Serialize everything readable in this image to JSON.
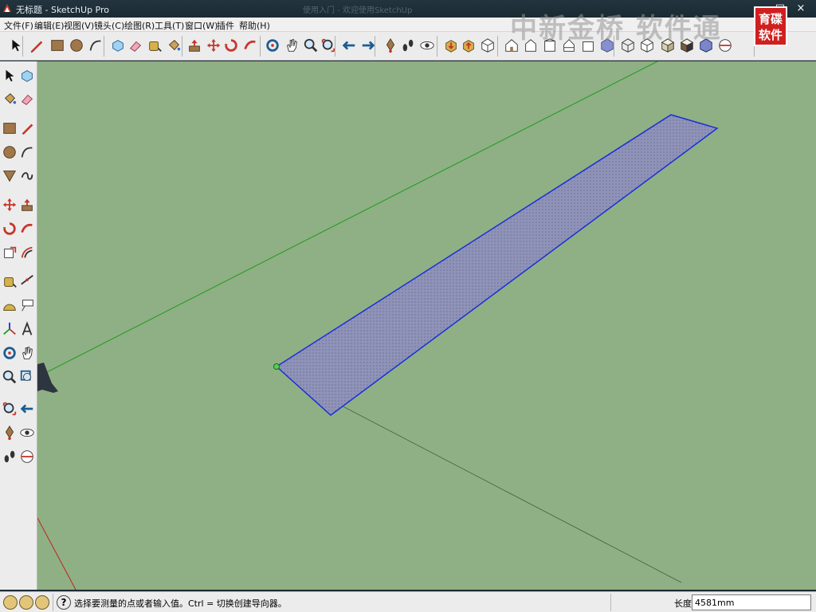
{
  "window": {
    "title": "无标题 - SketchUp Pro",
    "ghost_title": "使用入门 - 欢迎使用SketchUp",
    "controls": [
      "−",
      "□",
      "×"
    ]
  },
  "menu": [
    {
      "label": "文件(F)"
    },
    {
      "label": "编辑(E)"
    },
    {
      "label": "视图(V)"
    },
    {
      "label": "镜头(C)"
    },
    {
      "label": "绘图(R)"
    },
    {
      "label": "工具(T)"
    },
    {
      "label": "窗口(W)"
    },
    {
      "label": "插件"
    },
    {
      "label": "帮助(H)"
    }
  ],
  "watermark": {
    "text": "中新金桥 软件通",
    "logo_top": "育碟",
    "logo_bottom": "软件"
  },
  "top_toolbar": [
    {
      "name": "select-icon"
    },
    {
      "name": "pencil-line-icon"
    },
    {
      "name": "rectangle-icon"
    },
    {
      "name": "circle-icon"
    },
    {
      "name": "arc-icon"
    },
    {
      "name": "make-component-icon"
    },
    {
      "name": "eraser-icon"
    },
    {
      "name": "tape-measure-icon"
    },
    {
      "name": "paint-bucket-icon"
    },
    {
      "name": "push-pull-icon"
    },
    {
      "name": "move-icon"
    },
    {
      "name": "rotate-icon"
    },
    {
      "name": "follow-me-icon"
    },
    {
      "name": "orbit-icon"
    },
    {
      "name": "pan-icon"
    },
    {
      "name": "zoom-icon"
    },
    {
      "name": "zoom-extents-icon"
    },
    {
      "name": "previous-view-icon"
    },
    {
      "name": "next-view-icon"
    },
    {
      "name": "position-camera-icon"
    },
    {
      "name": "walk-icon"
    },
    {
      "name": "look-around-icon"
    },
    {
      "name": "get-models-icon"
    },
    {
      "name": "share-model-icon"
    },
    {
      "name": "iso-view-icon"
    },
    {
      "name": "top-view-icon"
    },
    {
      "name": "front-view-icon"
    },
    {
      "name": "right-view-icon"
    },
    {
      "name": "back-view-icon"
    },
    {
      "name": "left-view-icon"
    },
    {
      "name": "xray-style-icon"
    },
    {
      "name": "wireframe-style-icon"
    },
    {
      "name": "hidden-line-style-icon"
    },
    {
      "name": "shaded-style-icon"
    },
    {
      "name": "shaded-textures-style-icon"
    },
    {
      "name": "monochrome-style-icon"
    },
    {
      "name": "section-plane-icon"
    }
  ],
  "left_toolbar": [
    {
      "name": "select-icon"
    },
    {
      "name": "make-component-icon"
    },
    {
      "name": "paint-bucket-icon"
    },
    {
      "name": "eraser-icon"
    },
    {
      "name": "rectangle-icon"
    },
    {
      "name": "line-icon"
    },
    {
      "name": "circle-icon"
    },
    {
      "name": "arc-icon"
    },
    {
      "name": "polygon-icon"
    },
    {
      "name": "freehand-icon"
    },
    {
      "name": "move-icon"
    },
    {
      "name": "push-pull-icon"
    },
    {
      "name": "rotate-icon"
    },
    {
      "name": "follow-me-icon"
    },
    {
      "name": "scale-icon"
    },
    {
      "name": "offset-icon"
    },
    {
      "name": "tape-measure-icon"
    },
    {
      "name": "dimension-icon"
    },
    {
      "name": "protractor-icon"
    },
    {
      "name": "text-icon"
    },
    {
      "name": "axes-icon"
    },
    {
      "name": "3d-text-icon"
    },
    {
      "name": "orbit-icon"
    },
    {
      "name": "pan-icon"
    },
    {
      "name": "zoom-icon"
    },
    {
      "name": "zoom-window-icon"
    },
    {
      "name": "zoom-extents-icon"
    },
    {
      "name": "previous-view-icon"
    },
    {
      "name": "position-camera-icon"
    },
    {
      "name": "look-around-icon"
    },
    {
      "name": "walk-icon"
    },
    {
      "name": "section-plane-icon"
    }
  ],
  "viewport": {
    "background": "#8fb084",
    "face_fill": "#8f93b8",
    "edge_color": "#1b2fd9",
    "green_axis": "#1e9b1e",
    "red_axis": "#c02020"
  },
  "status": {
    "hint": "选择要测量的点或者输入值。Ctrl = 切换创建导向器。",
    "vcb_label": "长度",
    "vcb_value": "4581mm",
    "help_icon": "?"
  }
}
